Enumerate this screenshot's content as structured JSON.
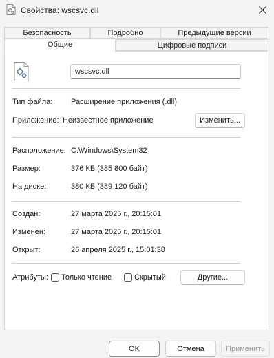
{
  "window": {
    "title": "Свойства: wscsvc.dll"
  },
  "tabs": {
    "security": "Безопасность",
    "details": "Подробно",
    "previous_versions": "Предыдущие версии",
    "general": "Общие",
    "digital_signatures": "Цифровые подписи",
    "active": "Общие"
  },
  "general": {
    "file_name": "wscsvc.dll",
    "file_type_label": "Тип файла:",
    "file_type_value": "Расширение приложения (.dll)",
    "opens_with_label": "Приложение:",
    "opens_with_value": "Неизвестное приложение",
    "change_button": "Изменить...",
    "location_label": "Расположение:",
    "location_value": "C:\\Windows\\System32",
    "size_label": "Размер:",
    "size_value": "376 КБ (385 800 байт)",
    "size_on_disk_label": "На диске:",
    "size_on_disk_value": "380 КБ (389 120 байт)",
    "created_label": "Создан:",
    "created_value": "27 марта 2025 г., 20:15:01",
    "modified_label": "Изменен:",
    "modified_value": "27 марта 2025 г., 20:15:01",
    "accessed_label": "Открыт:",
    "accessed_value": "26 апреля 2025 г., 15:01:38",
    "attributes_label": "Атрибуты:",
    "readonly_label": "Только чтение",
    "readonly_checked": false,
    "hidden_label": "Скрытый",
    "hidden_checked": false,
    "advanced_button": "Другие..."
  },
  "footer": {
    "ok_button": "OK",
    "cancel_button": "Отмена",
    "apply_button": "Применить"
  },
  "icons": {
    "title_icon": "dll-file-icon",
    "close": "close-icon",
    "file": "dll-file-icon"
  }
}
